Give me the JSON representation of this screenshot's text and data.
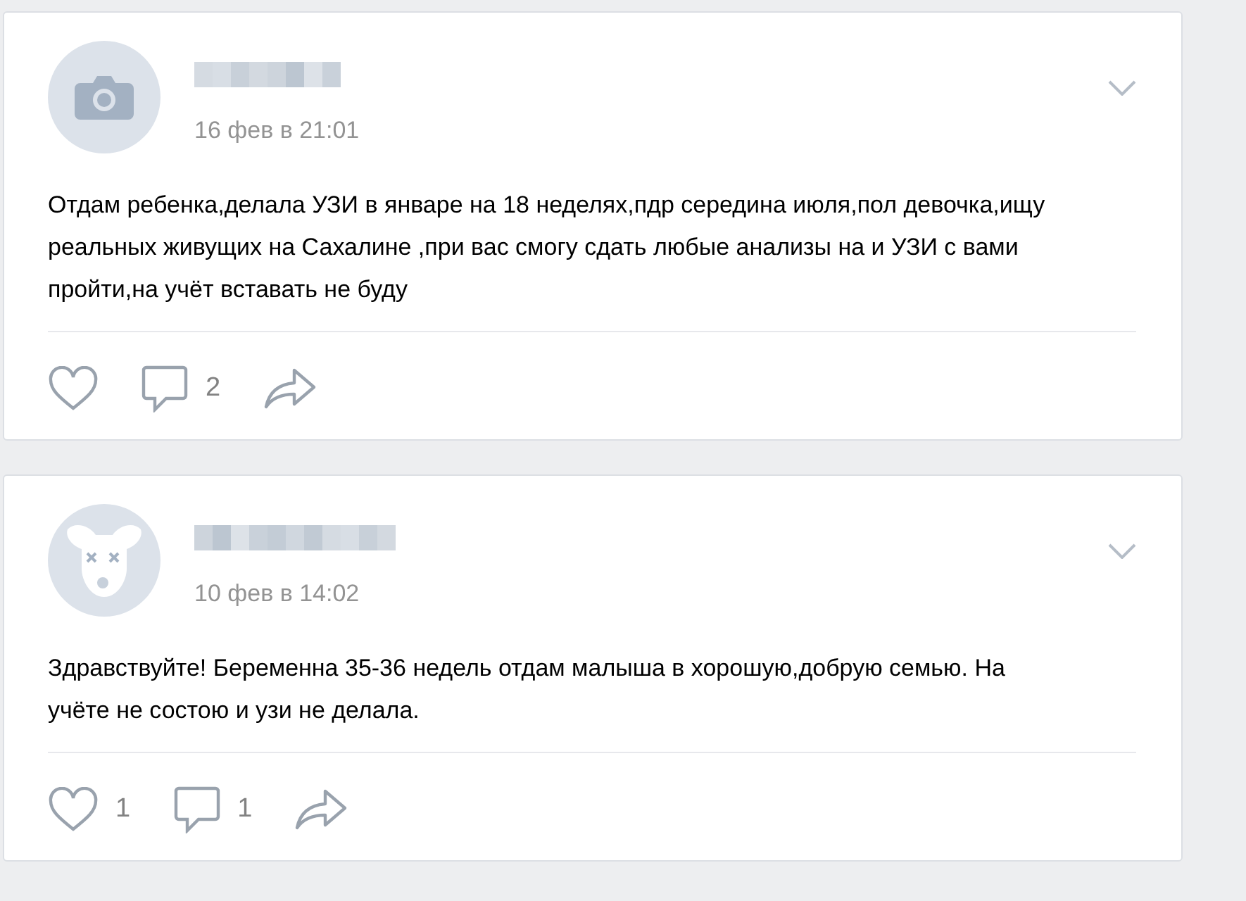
{
  "posts": [
    {
      "avatar": {
        "kind": "camera"
      },
      "author": {
        "redacted": true
      },
      "date": "16 фев в 21:01",
      "text": "Отдам ребенка,делала УЗИ в январе на 18 неделях,пдр середина июля,пол девочка,ищу реальных живущих на Сахалине ,при вас смогу сдать любые анализы на и УЗИ с вами пройти,на учёт вставать не буду",
      "comments": {
        "count": "2"
      }
    },
    {
      "avatar": {
        "kind": "dog"
      },
      "author": {
        "redacted": true
      },
      "date": "10 фев в 14:02",
      "text": "Здравствуйте! Беременна 35-36 недель отдам малыша в хорошую,добрую семью. На учёте не состою и узи не делала.",
      "likes": {
        "count": "1"
      },
      "comments": {
        "count": "1"
      }
    }
  ]
}
